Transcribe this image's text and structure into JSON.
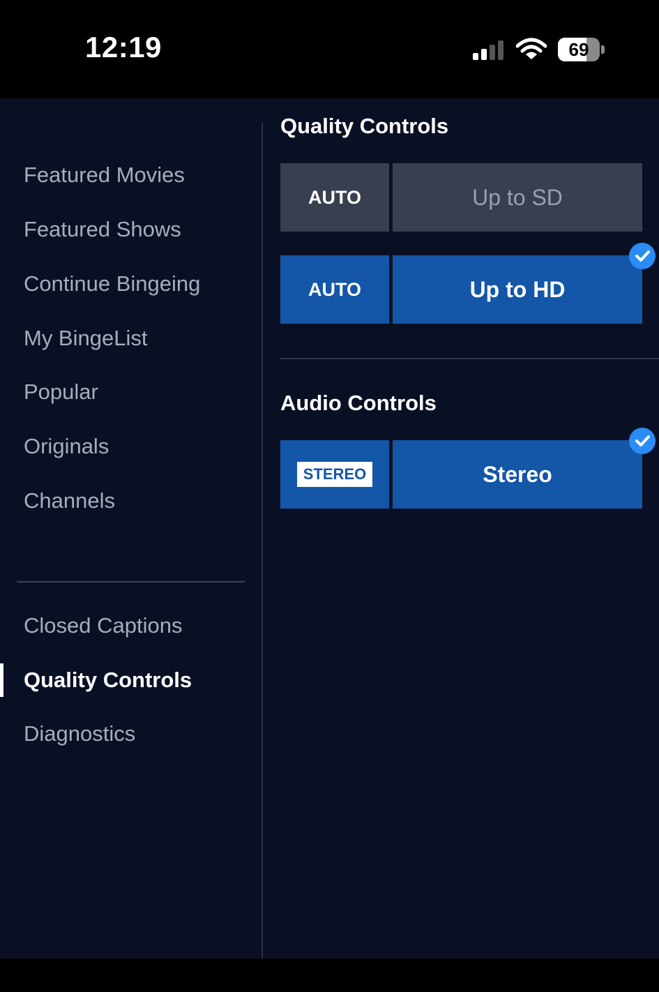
{
  "status_bar": {
    "time": "12:19",
    "battery_percent": "69",
    "battery_level": 0.69,
    "signal_bars_active": 2,
    "signal_bars_total": 4,
    "icons": [
      "cellular-signal-icon",
      "wifi-icon",
      "battery-icon"
    ]
  },
  "sidebar": {
    "browse_items": [
      {
        "label": "Featured Movies"
      },
      {
        "label": "Featured Shows"
      },
      {
        "label": "Continue Bingeing"
      },
      {
        "label": "My BingeList"
      },
      {
        "label": "Popular"
      },
      {
        "label": "Originals"
      },
      {
        "label": "Channels"
      }
    ],
    "settings_items": [
      {
        "label": "Closed Captions"
      },
      {
        "label": "Quality Controls",
        "active": true
      },
      {
        "label": "Diagnostics"
      }
    ]
  },
  "quality": {
    "title": "Quality Controls",
    "options": [
      {
        "badge": "AUTO",
        "label": "Up to SD",
        "selected": false
      },
      {
        "badge": "AUTO",
        "label": "Up to HD",
        "selected": true
      }
    ]
  },
  "audio": {
    "title": "Audio Controls",
    "options": [
      {
        "badge": "STEREO",
        "label": "Stereo",
        "selected": true
      }
    ]
  },
  "colors": {
    "background": "#0a1024",
    "selected_tile": "#1456a8",
    "inactive_tile": "#383f4f",
    "check_badge": "#2a8cf5"
  }
}
